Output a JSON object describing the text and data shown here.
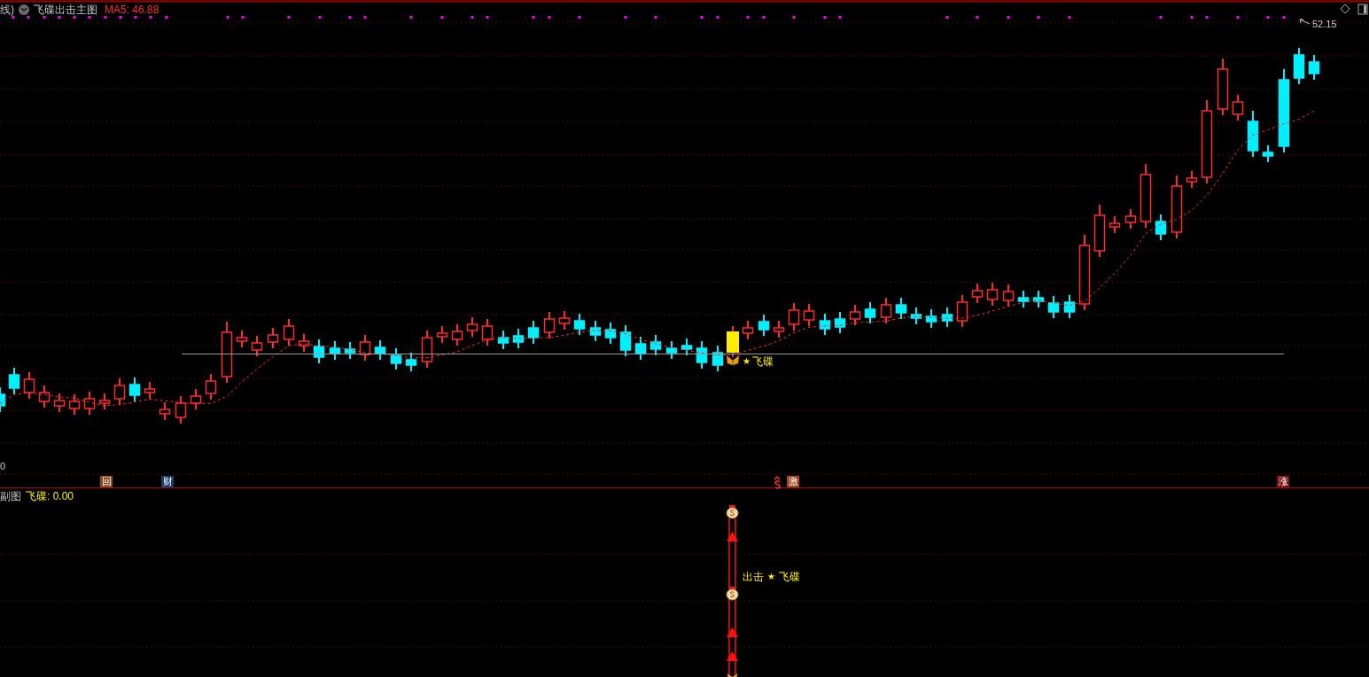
{
  "header": {
    "period": "线)",
    "indicator": "飞碟出击主图",
    "ma": "MA5: 46.88"
  },
  "main_chart": {
    "high_label": "52.15",
    "axis_label": "0",
    "signal": {
      "star": "★",
      "text": "飞碟"
    },
    "badges": [
      {
        "text": "回",
        "color": "#8b4a1c"
      },
      {
        "text": "财",
        "color": "#1c3c6c"
      },
      {
        "text": "激",
        "color": "#a0441c"
      },
      {
        "text": "涨",
        "color": "#7a1010"
      }
    ]
  },
  "sub_chart": {
    "title": "副图",
    "value": "飞碟: 0.00",
    "signal": {
      "action": "出击",
      "star": "★",
      "text": "飞碟"
    }
  }
}
